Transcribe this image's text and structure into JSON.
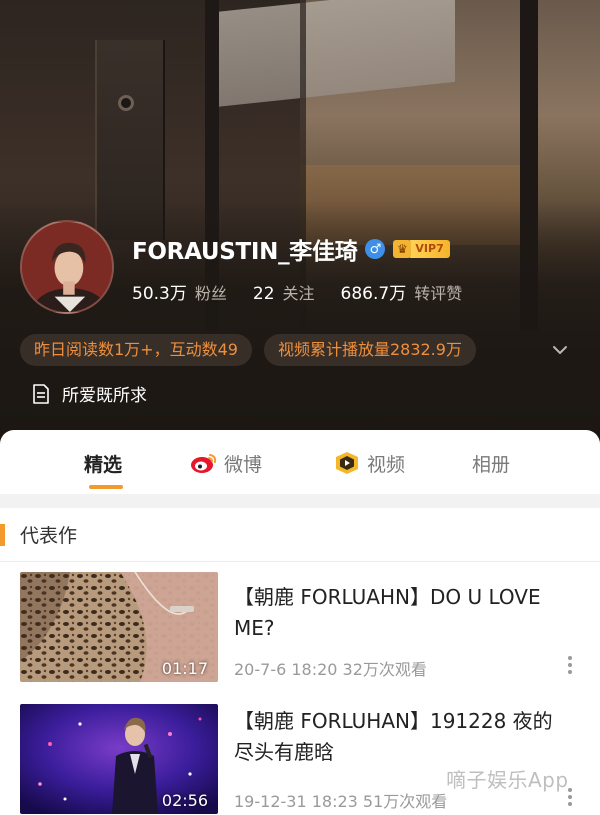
{
  "profile": {
    "name": "FORAUSTIN_李佳琦",
    "gender_icon": "male-icon",
    "vip_label": "VIP7",
    "stats": [
      {
        "value": "50.3万",
        "label": "粉丝"
      },
      {
        "value": "22",
        "label": "关注"
      },
      {
        "value": "686.7万",
        "label": "转评赞"
      }
    ],
    "metrics": [
      "昨日阅读数1万+，互动数49",
      "视频累计播放量2832.9万"
    ],
    "bio": "所爱既所求"
  },
  "tabs": [
    {
      "label": "精选",
      "icon": null
    },
    {
      "label": "微博",
      "icon": "weibo-icon"
    },
    {
      "label": "视频",
      "icon": "video-channel-icon"
    },
    {
      "label": "相册",
      "icon": null
    }
  ],
  "section": {
    "title": "代表作"
  },
  "videos": [
    {
      "title": "【朝鹿 FORLUAHN】DO U LOVE ME?",
      "duration": "01:17",
      "meta": "20-7-6 18:20 32万次观看"
    },
    {
      "title": "【朝鹿 FORLUHAN】191228 夜的尽头有鹿晗",
      "duration": "02:56",
      "meta": "19-12-31 18:23 51万次观看"
    }
  ],
  "watermark": "嘀子娱乐App",
  "colors": {
    "accent": "#f29a2e",
    "metric_text": "#ee8f3c",
    "gender": "#3d8fe8"
  }
}
